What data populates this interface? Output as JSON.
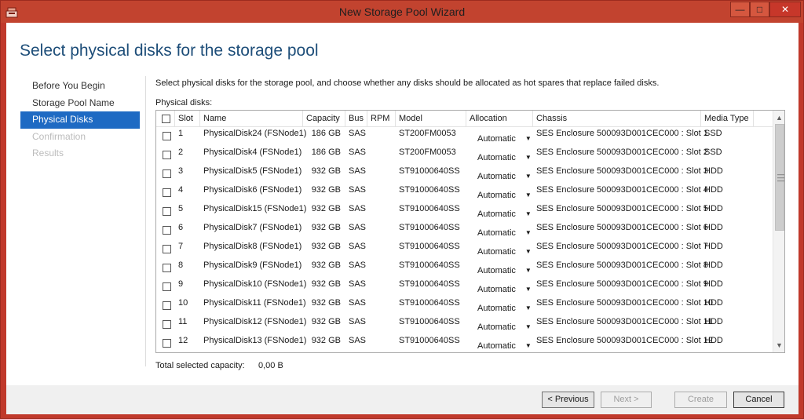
{
  "window": {
    "title": "New Storage Pool Wizard"
  },
  "page": {
    "heading": "Select physical disks for the storage pool",
    "description": "Select physical disks for the storage pool, and choose whether any disks should be allocated as hot spares that replace failed disks.",
    "disks_label": "Physical disks:",
    "total_label": "Total selected capacity:",
    "total_value": "0,00 B"
  },
  "nav": {
    "items": [
      {
        "label": "Before You Begin",
        "state": "normal"
      },
      {
        "label": "Storage Pool Name",
        "state": "normal"
      },
      {
        "label": "Physical Disks",
        "state": "active"
      },
      {
        "label": "Confirmation",
        "state": "disabled"
      },
      {
        "label": "Results",
        "state": "disabled"
      }
    ]
  },
  "table": {
    "headers": {
      "slot": "Slot",
      "name": "Name",
      "capacity": "Capacity",
      "bus": "Bus",
      "rpm": "RPM",
      "model": "Model",
      "allocation": "Allocation",
      "chassis": "Chassis",
      "media_type": "Media Type"
    },
    "rows": [
      {
        "slot": "1",
        "name": "PhysicalDisk24 (FSNode1)",
        "capacity": "186 GB",
        "bus": "SAS",
        "rpm": "",
        "model": "ST200FM0053",
        "allocation": "Automatic",
        "chassis": "SES Enclosure 500093D001CEC000 : Slot 1",
        "media_type": "SSD"
      },
      {
        "slot": "2",
        "name": "PhysicalDisk4 (FSNode1)",
        "capacity": "186 GB",
        "bus": "SAS",
        "rpm": "",
        "model": "ST200FM0053",
        "allocation": "Automatic",
        "chassis": "SES Enclosure 500093D001CEC000 : Slot 2",
        "media_type": "SSD"
      },
      {
        "slot": "3",
        "name": "PhysicalDisk5 (FSNode1)",
        "capacity": "932 GB",
        "bus": "SAS",
        "rpm": "",
        "model": "ST91000640SS",
        "allocation": "Automatic",
        "chassis": "SES Enclosure 500093D001CEC000 : Slot 3",
        "media_type": "HDD"
      },
      {
        "slot": "4",
        "name": "PhysicalDisk6 (FSNode1)",
        "capacity": "932 GB",
        "bus": "SAS",
        "rpm": "",
        "model": "ST91000640SS",
        "allocation": "Automatic",
        "chassis": "SES Enclosure 500093D001CEC000 : Slot 4",
        "media_type": "HDD"
      },
      {
        "slot": "5",
        "name": "PhysicalDisk15 (FSNode1)",
        "capacity": "932 GB",
        "bus": "SAS",
        "rpm": "",
        "model": "ST91000640SS",
        "allocation": "Automatic",
        "chassis": "SES Enclosure 500093D001CEC000 : Slot 5",
        "media_type": "HDD"
      },
      {
        "slot": "6",
        "name": "PhysicalDisk7 (FSNode1)",
        "capacity": "932 GB",
        "bus": "SAS",
        "rpm": "",
        "model": "ST91000640SS",
        "allocation": "Automatic",
        "chassis": "SES Enclosure 500093D001CEC000 : Slot 6",
        "media_type": "HDD"
      },
      {
        "slot": "7",
        "name": "PhysicalDisk8 (FSNode1)",
        "capacity": "932 GB",
        "bus": "SAS",
        "rpm": "",
        "model": "ST91000640SS",
        "allocation": "Automatic",
        "chassis": "SES Enclosure 500093D001CEC000 : Slot 7",
        "media_type": "HDD"
      },
      {
        "slot": "8",
        "name": "PhysicalDisk9 (FSNode1)",
        "capacity": "932 GB",
        "bus": "SAS",
        "rpm": "",
        "model": "ST91000640SS",
        "allocation": "Automatic",
        "chassis": "SES Enclosure 500093D001CEC000 : Slot 8",
        "media_type": "HDD"
      },
      {
        "slot": "9",
        "name": "PhysicalDisk10 (FSNode1)",
        "capacity": "932 GB",
        "bus": "SAS",
        "rpm": "",
        "model": "ST91000640SS",
        "allocation": "Automatic",
        "chassis": "SES Enclosure 500093D001CEC000 : Slot 9",
        "media_type": "HDD"
      },
      {
        "slot": "10",
        "name": "PhysicalDisk11 (FSNode1)",
        "capacity": "932 GB",
        "bus": "SAS",
        "rpm": "",
        "model": "ST91000640SS",
        "allocation": "Automatic",
        "chassis": "SES Enclosure 500093D001CEC000 : Slot 10",
        "media_type": "HDD"
      },
      {
        "slot": "11",
        "name": "PhysicalDisk12 (FSNode1)",
        "capacity": "932 GB",
        "bus": "SAS",
        "rpm": "",
        "model": "ST91000640SS",
        "allocation": "Automatic",
        "chassis": "SES Enclosure 500093D001CEC000 : Slot 11",
        "media_type": "HDD"
      },
      {
        "slot": "12",
        "name": "PhysicalDisk13 (FSNode1)",
        "capacity": "932 GB",
        "bus": "SAS",
        "rpm": "",
        "model": "ST91000640SS",
        "allocation": "Automatic",
        "chassis": "SES Enclosure 500093D001CEC000 : Slot 12",
        "media_type": "HDD"
      }
    ]
  },
  "buttons": {
    "previous": "< Previous",
    "next": "Next >",
    "create": "Create",
    "cancel": "Cancel"
  },
  "colors": {
    "titlebar": "#c2432f",
    "heading": "#1e4e79",
    "nav_active": "#1e6ac3"
  }
}
